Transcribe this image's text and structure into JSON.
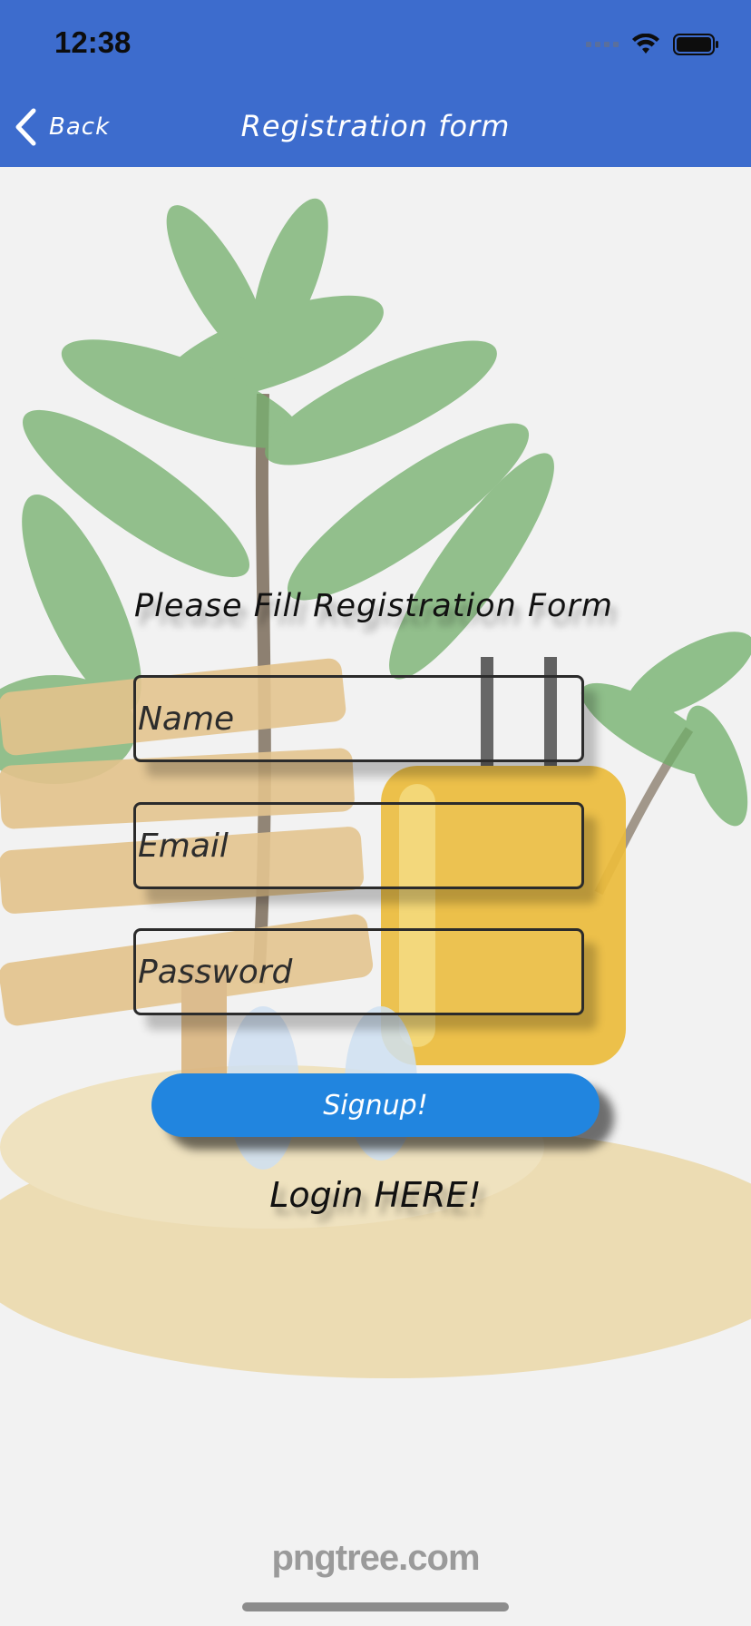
{
  "status_bar": {
    "time": "12:38"
  },
  "nav": {
    "back_label": "Back",
    "title": "Registration form"
  },
  "form": {
    "heading": "Please Fill Registration Form",
    "name_placeholder": "Name",
    "email_placeholder": "Email",
    "password_placeholder": "Password",
    "signup_label": "Signup!",
    "login_label": "Login HERE!"
  },
  "watermark": "pngtree.com",
  "colors": {
    "nav_bar": "#3d6ccd",
    "signup_button": "#2185df",
    "background": "#f2f2f2"
  }
}
